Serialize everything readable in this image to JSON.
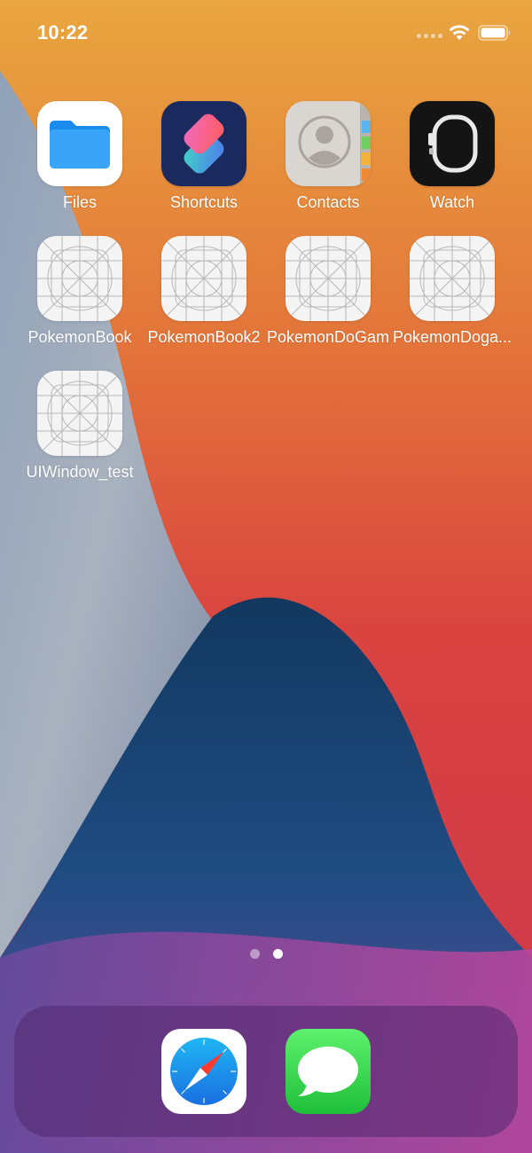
{
  "status_bar": {
    "time": "10:22",
    "icons": [
      "cellular-signal-icon",
      "wifi-icon",
      "battery-icon"
    ]
  },
  "home": {
    "apps": [
      {
        "name": "Files",
        "icon": "files-icon"
      },
      {
        "name": "Shortcuts",
        "icon": "shortcuts-icon"
      },
      {
        "name": "Contacts",
        "icon": "contacts-icon"
      },
      {
        "name": "Watch",
        "icon": "watch-icon"
      },
      {
        "name": "PokemonBook",
        "icon": "placeholder-app-icon"
      },
      {
        "name": "PokemonBook2",
        "icon": "placeholder-app-icon"
      },
      {
        "name": "PokemonDoGam",
        "icon": "placeholder-app-icon"
      },
      {
        "name": "PokemonDoga...",
        "icon": "placeholder-app-icon"
      },
      {
        "name": "UIWindow_test",
        "icon": "placeholder-app-icon"
      }
    ],
    "page_count": 2,
    "current_page": 2
  },
  "dock": {
    "apps": [
      {
        "icon": "safari-icon"
      },
      {
        "icon": "messages-icon"
      }
    ]
  },
  "colors": {
    "wallpaper_orange": "#e8a040",
    "wallpaper_red": "#d63a3e",
    "wallpaper_blue": "#1f4a7a",
    "wallpaper_grey": "#a3adbb",
    "files_blue": "#2196f3",
    "messages_green": "#34c759"
  }
}
